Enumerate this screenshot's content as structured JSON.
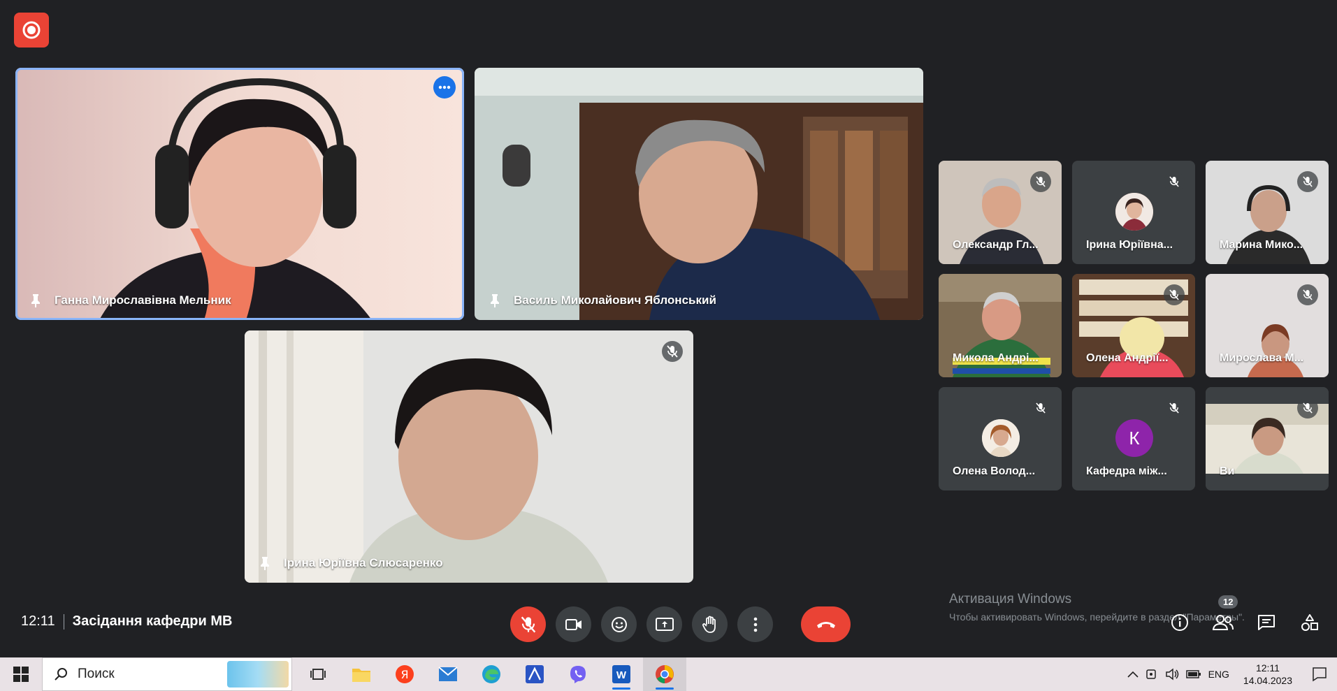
{
  "meeting": {
    "time": "12:11",
    "title": "Засідання кафедри МВ"
  },
  "main_tiles": [
    {
      "name": "Ганна Мирославівна Мельник"
    },
    {
      "name": "Василь Миколайович Яблонський"
    },
    {
      "name": "Ірина Юріївна Слюсаренко"
    }
  ],
  "small_tiles": [
    {
      "name": "Олександр Гл..."
    },
    {
      "name": "Ірина Юріївна..."
    },
    {
      "name": "Марина Мико..."
    },
    {
      "name": "Микола Андрі..."
    },
    {
      "name": "Олена Андрії..."
    },
    {
      "name": "Мирослава М..."
    },
    {
      "name": "Олена Волод..."
    },
    {
      "name": "Кафедра між...",
      "avatar_letter": "К",
      "avatar_color": "#8e24aa"
    },
    {
      "name": "Ви"
    }
  ],
  "participants_count": "12",
  "watermark": {
    "line1": "Активация Windows",
    "line2": "Чтобы активировать Windows, перейдите в раздел \"Параметры\"."
  },
  "taskbar": {
    "search_placeholder": "Поиск",
    "lang": "ENG",
    "clock_time": "12:11",
    "clock_date": "14.04.2023"
  },
  "colors": {
    "background": "#202124",
    "danger": "#ea4335",
    "accent": "#8ab4f8"
  }
}
